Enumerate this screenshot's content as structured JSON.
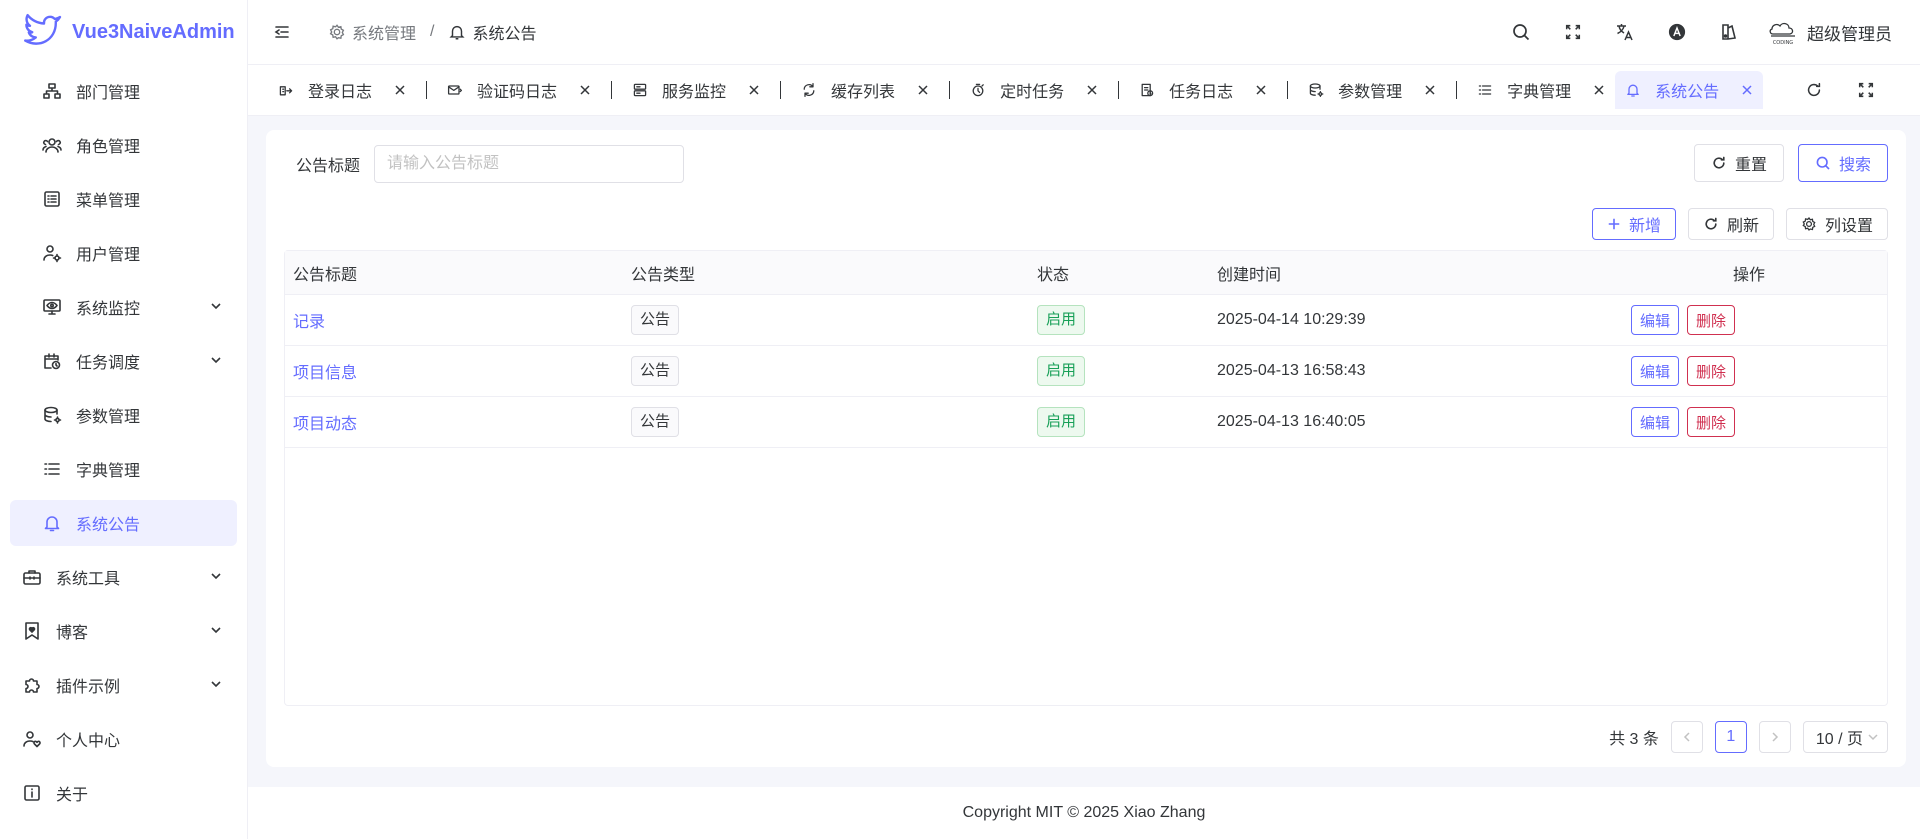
{
  "brand": {
    "name": "Vue3NaiveAdmin",
    "color": "#646cff"
  },
  "sidebar": {
    "items": [
      {
        "label": "部门管理",
        "icon": "org-chart-icon",
        "level": "sub"
      },
      {
        "label": "角色管理",
        "icon": "users-icon",
        "level": "sub"
      },
      {
        "label": "菜单管理",
        "icon": "list-box-icon",
        "level": "sub"
      },
      {
        "label": "用户管理",
        "icon": "user-gear-icon",
        "level": "sub"
      },
      {
        "label": "系统监控",
        "icon": "monitor-eye-icon",
        "level": "sub",
        "expandable": true
      },
      {
        "label": "任务调度",
        "icon": "calendar-clock-icon",
        "level": "sub",
        "expandable": true
      },
      {
        "label": "参数管理",
        "icon": "database-gear-icon",
        "level": "sub"
      },
      {
        "label": "字典管理",
        "icon": "list-icon",
        "level": "sub"
      },
      {
        "label": "系统公告",
        "icon": "bell-icon",
        "level": "sub",
        "active": true
      },
      {
        "label": "系统工具",
        "icon": "toolbox-icon",
        "level": "top",
        "expandable": true
      },
      {
        "label": "博客",
        "icon": "bookmark-heart-icon",
        "level": "top",
        "expandable": true
      },
      {
        "label": "插件示例",
        "icon": "puzzle-icon",
        "level": "top",
        "expandable": true
      },
      {
        "label": "个人中心",
        "icon": "user-heart-icon",
        "level": "top"
      },
      {
        "label": "关于",
        "icon": "info-box-icon",
        "level": "top"
      }
    ]
  },
  "header": {
    "breadcrumb": [
      {
        "label": "系统管理",
        "icon": "gear-icon"
      },
      {
        "label": "系统公告",
        "icon": "bell-icon"
      }
    ],
    "breadcrumb_separator": "/",
    "user_name": "超级管理员"
  },
  "tabs": [
    {
      "label": "登录日志",
      "icon": "login-log-icon"
    },
    {
      "label": "验证码日志",
      "icon": "mail-code-icon"
    },
    {
      "label": "服务监控",
      "icon": "server-icon"
    },
    {
      "label": "缓存列表",
      "icon": "refresh-cache-icon"
    },
    {
      "label": "定时任务",
      "icon": "timer-icon"
    },
    {
      "label": "任务日志",
      "icon": "task-log-icon"
    },
    {
      "label": "参数管理",
      "icon": "database-gear-icon"
    },
    {
      "label": "字典管理",
      "icon": "list-icon"
    },
    {
      "label": "系统公告",
      "icon": "bell-icon",
      "active": true
    }
  ],
  "search": {
    "label": "公告标题",
    "placeholder": "请输入公告标题",
    "reset_label": "重置",
    "search_label": "搜索"
  },
  "toolbar": {
    "add_label": "新增",
    "refresh_label": "刷新",
    "columns_label": "列设置"
  },
  "table": {
    "columns": [
      "公告标题",
      "公告类型",
      "状态",
      "创建时间",
      "操作"
    ],
    "rows": [
      {
        "title": "记录",
        "type": "公告",
        "status": "启用",
        "created": "2025-04-14 10:29:39",
        "edit": "编辑",
        "delete": "删除"
      },
      {
        "title": "项目信息",
        "type": "公告",
        "status": "启用",
        "created": "2025-04-13 16:58:43",
        "edit": "编辑",
        "delete": "删除"
      },
      {
        "title": "项目动态",
        "type": "公告",
        "status": "启用",
        "created": "2025-04-13 16:40:05",
        "edit": "编辑",
        "delete": "删除"
      }
    ]
  },
  "pagination": {
    "total_text": "共 3 条",
    "current_page": "1",
    "page_size": "10 / 页"
  },
  "footer": {
    "text": "Copyright MIT © 2025 Xiao Zhang"
  }
}
